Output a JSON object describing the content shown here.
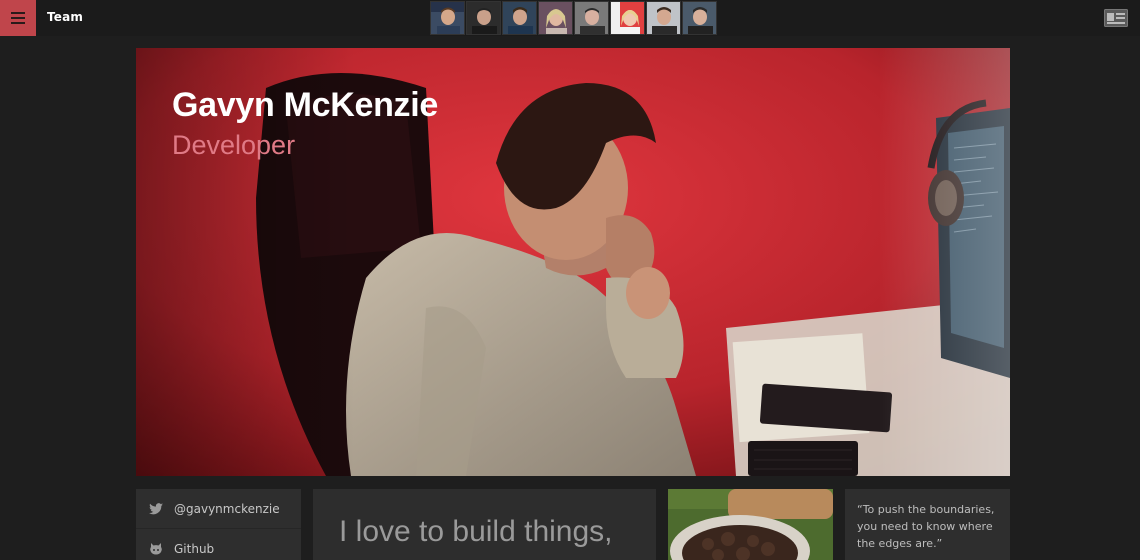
{
  "topbar": {
    "brand": "Team",
    "team_members": [
      "member-1",
      "member-2",
      "member-3",
      "member-4",
      "member-5",
      "member-6",
      "member-7",
      "member-8"
    ]
  },
  "hero": {
    "name": "Gavyn McKenzie",
    "role": "Developer"
  },
  "social": {
    "items": [
      {
        "label": "@gavynmckenzie",
        "icon": "twitter-icon"
      },
      {
        "label": "Github",
        "icon": "github-icon"
      }
    ]
  },
  "statement": "I love to build things,",
  "quote": "“To push the boundaries, you need to know where the edges are.”",
  "colors": {
    "accent": "#c0454b",
    "hero_red": "#b8262d",
    "role_pink": "#e07a86",
    "background": "#1e1e1e",
    "panel": "#2e2e2e"
  }
}
